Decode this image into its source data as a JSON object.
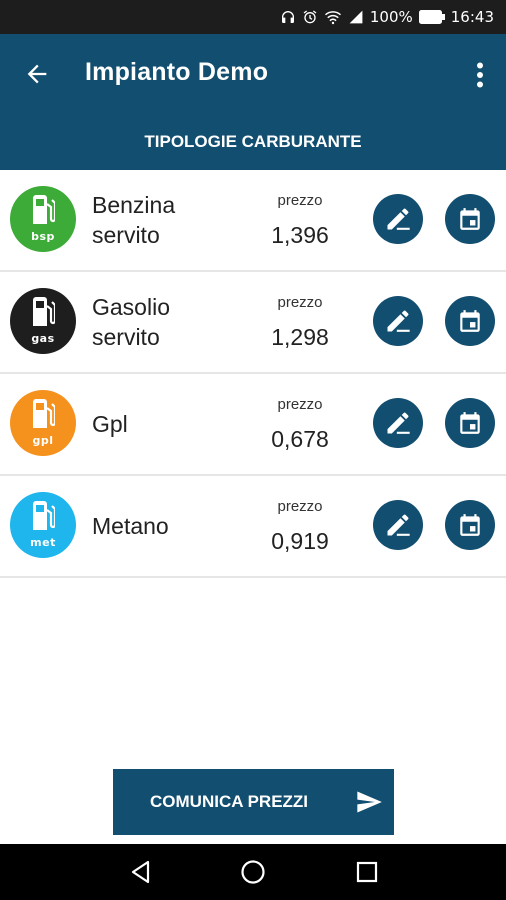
{
  "status_bar": {
    "battery": "100%",
    "time": "16:43",
    "icons": [
      "headphones-icon",
      "alarm-icon",
      "wifi-icon",
      "signal-icon",
      "battery-icon"
    ]
  },
  "app_bar": {
    "title": "Impianto Demo",
    "back_icon": "arrow-back-icon",
    "menu_icon": "more-vert-icon"
  },
  "tab": {
    "label": "TIPOLOGIE CARBURANTE"
  },
  "fuels": [
    {
      "name_line1": "Benzina",
      "name_line2": "servito",
      "code": "bsp",
      "color": "#3dab37",
      "price_label": "prezzo",
      "price": "1,396"
    },
    {
      "name_line1": "Gasolio",
      "name_line2": "servito",
      "code": "gas",
      "color": "#1e1e1e",
      "price_label": "prezzo",
      "price": "1,298"
    },
    {
      "name_line1": "Gpl",
      "name_line2": "",
      "code": "gpl",
      "color": "#f5921e",
      "price_label": "prezzo",
      "price": "0,678"
    },
    {
      "name_line1": "Metano",
      "name_line2": "",
      "code": "met",
      "color": "#1eb6ec",
      "price_label": "prezzo",
      "price": "0,919"
    }
  ],
  "row_actions": {
    "edit_icon": "edit-pencil-icon",
    "calendar_icon": "calendar-icon"
  },
  "send_button": {
    "label": "COMUNICA PREZZI",
    "icon": "send-icon"
  },
  "colors": {
    "primary": "#124e6f",
    "status_bar": "#1d1d1d",
    "nav_bar": "#000000"
  },
  "nav_bar": {
    "icons": [
      "nav-back-icon",
      "nav-home-icon",
      "nav-recents-icon"
    ]
  }
}
